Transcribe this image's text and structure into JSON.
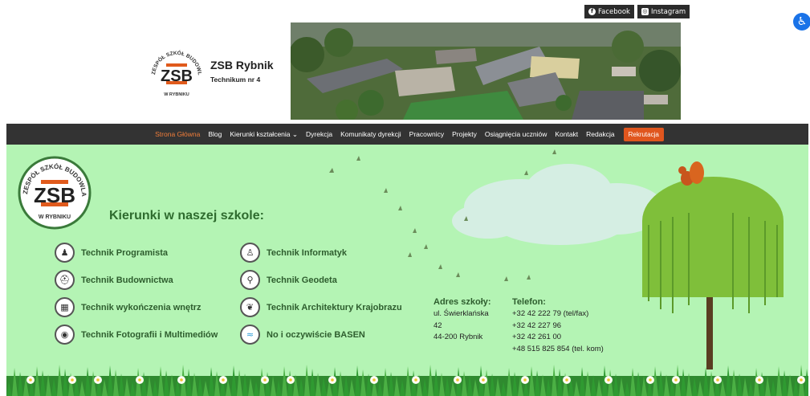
{
  "social": {
    "facebook_label": "Facebook",
    "instagram_label": "Instagram"
  },
  "header": {
    "brand_title": "ZSB Rybnik",
    "brand_subtitle": "Technikum nr 4",
    "logo_text_top": "ZESPÓŁ SZKÓŁ BUDOWLANYCH",
    "logo_letters": "ZSB",
    "logo_text_bottom": "W RYBNIKU"
  },
  "nav": {
    "items": [
      {
        "label": "Strona Główna",
        "active": true
      },
      {
        "label": "Blog"
      },
      {
        "label": "Kierunki kształcenia ⌄"
      },
      {
        "label": "Dyrekcja"
      },
      {
        "label": "Komunikaty dyrekcji"
      },
      {
        "label": "Pracownicy"
      },
      {
        "label": "Projekty"
      },
      {
        "label": "Osiągnięcia uczniów"
      },
      {
        "label": "Kontakt"
      },
      {
        "label": "Redakcja"
      }
    ],
    "cta_label": "Rekrutacja"
  },
  "hero": {
    "title": "Kierunki w naszej szkole:",
    "courses": [
      {
        "label": "Technik Programista",
        "icon": "programmer-icon"
      },
      {
        "label": "Technik Budownictwa",
        "icon": "helmet-icon"
      },
      {
        "label": "Technik wykończenia wnętrz",
        "icon": "interior-icon"
      },
      {
        "label": "Technik Fotografii i Multimediów",
        "icon": "camera-icon"
      },
      {
        "label": "Technik Informatyk",
        "icon": "it-icon"
      },
      {
        "label": "Technik Geodeta",
        "icon": "geodesy-icon"
      },
      {
        "label": "Technik Architektury Krajobrazu",
        "icon": "leaf-icon"
      },
      {
        "label": "No i oczywiście BASEN",
        "icon": "pool-icon"
      }
    ],
    "address": {
      "heading": "Adres szkoły:",
      "line1": "ul. Świerklańska",
      "line2": "42",
      "line3": "44-200 Rybnik"
    },
    "phone": {
      "heading": "Telefon:",
      "line1": "+32 42 222 79 (tel/fax)",
      "line2": "+32 42 227 96",
      "line3": "+32 42 261 00",
      "line4": "+48 515 825 854 (tel. kom)"
    }
  },
  "colors": {
    "nav_bg": "#333333",
    "nav_active": "#f07d3a",
    "cta": "#e0561e",
    "hero_bg": "#b4f4b4",
    "heading_green": "#2e6b2e"
  }
}
